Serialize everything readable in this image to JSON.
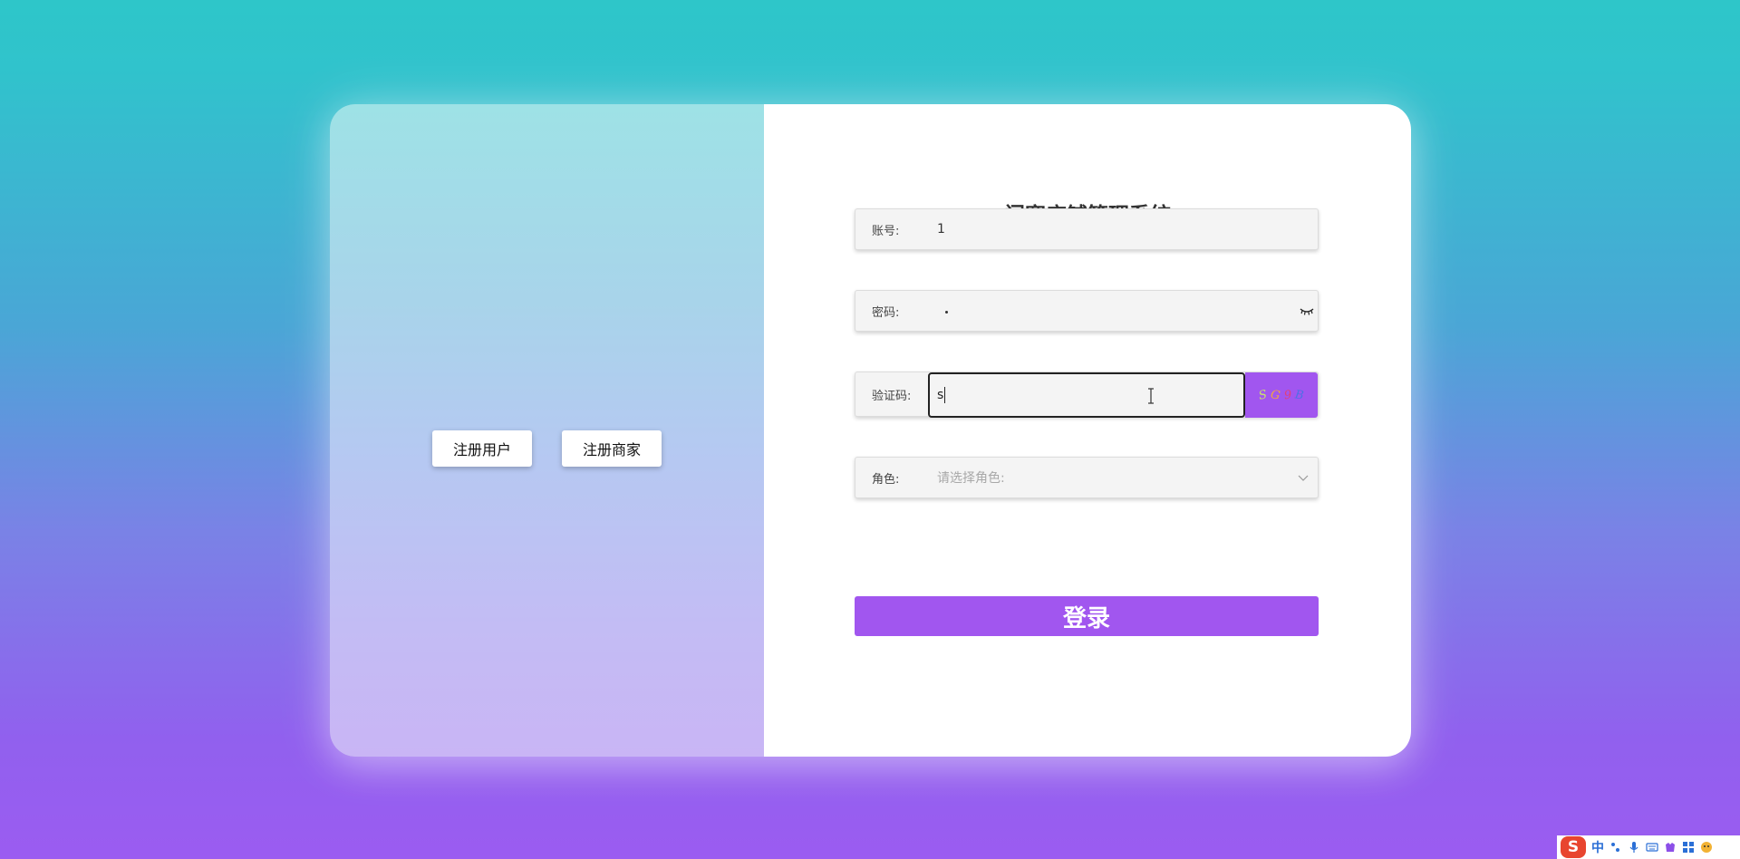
{
  "left_panel": {
    "register_user_label": "注册用户",
    "register_merchant_label": "注册商家"
  },
  "login_form": {
    "title": "门窗店铺管理系统",
    "account": {
      "label": "账号:",
      "value": "1"
    },
    "password": {
      "label": "密码:",
      "masked_value": "•"
    },
    "captcha": {
      "label": "验证码:",
      "value": "s",
      "image_chars": [
        "S",
        "G",
        "9",
        "B"
      ]
    },
    "role": {
      "label": "角色:",
      "placeholder": "请选择角色:"
    },
    "submit_label": "登录"
  },
  "ime_toolbar": {
    "logo": "S",
    "mode": "中",
    "icons": [
      "punctuation-icon",
      "microphone-icon",
      "keyboard-icon",
      "skin-icon",
      "toolbox-icon",
      "emoji-icon"
    ]
  },
  "colors": {
    "accent": "#a156ef",
    "background_top": "#2ec6c9",
    "background_bottom": "#9b5cf1"
  }
}
